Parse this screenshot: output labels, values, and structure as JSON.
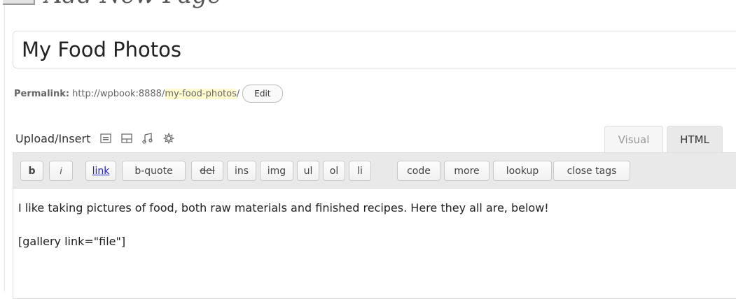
{
  "header": {
    "title": "Add New Page"
  },
  "title_field": {
    "value": "My Food Photos"
  },
  "permalink": {
    "label": "Permalink:",
    "base_url": "http://wpbook:8888/",
    "slug": "my-food-photos",
    "trailing_slash": "/",
    "edit_label": "Edit"
  },
  "media": {
    "label": "Upload/Insert",
    "icons": [
      "image-icon",
      "video-icon",
      "audio-icon",
      "media-icon"
    ]
  },
  "tabs": {
    "visual": "Visual",
    "html": "HTML",
    "active": "HTML"
  },
  "quicktags": [
    "b",
    "i",
    "link",
    "b-quote",
    "del",
    "ins",
    "img",
    "ul",
    "ol",
    "li",
    "code",
    "more",
    "lookup",
    "close tags"
  ],
  "content": {
    "line1": "I like taking pictures of food, both raw materials and finished recipes. Here they all are, below!",
    "line2": "[gallery link=\"file\"]"
  }
}
